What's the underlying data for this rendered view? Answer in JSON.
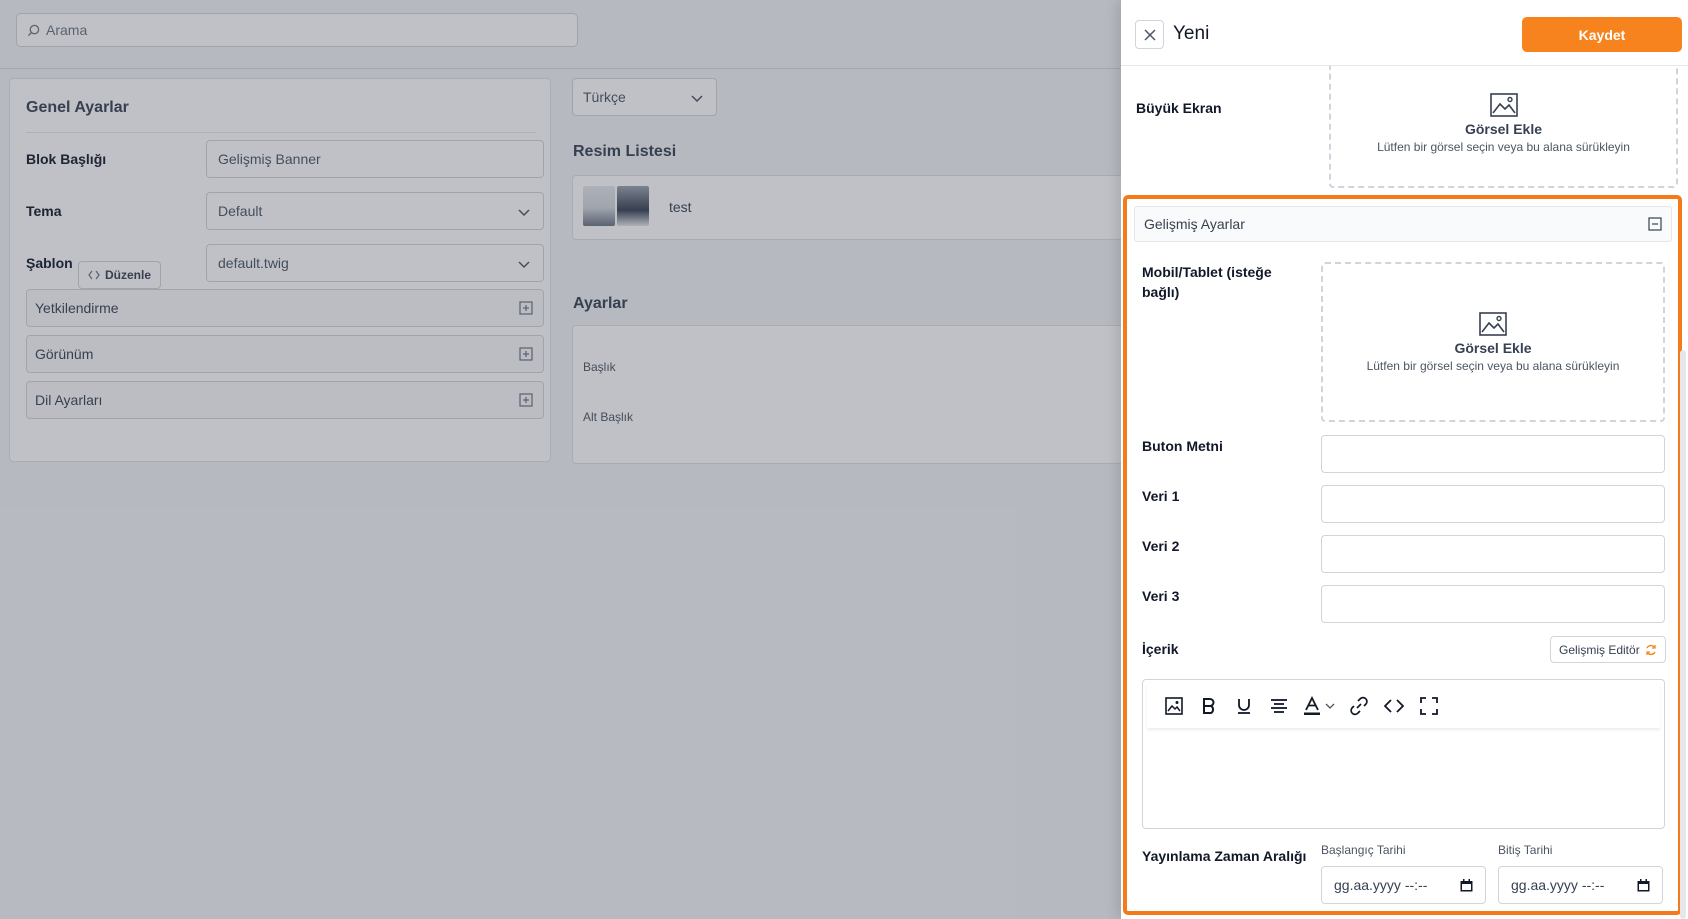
{
  "background": {
    "search_placeholder": "Arama",
    "general_settings": {
      "title": "Genel Ayarlar",
      "block_title_label": "Blok Başlığı",
      "block_title_value": "Gelişmiş Banner",
      "theme_label": "Tema",
      "theme_value": "Default",
      "template_label": "Şablon",
      "edit_button": "Düzenle",
      "template_value": "default.twig",
      "collapsibles": [
        "Yetkilendirme",
        "Görünüm",
        "Dil Ayarları"
      ]
    },
    "language_select": "Türkçe",
    "image_list": {
      "title": "Resim Listesi",
      "item_name": "test"
    },
    "settings": {
      "title": "Ayarlar",
      "fields": [
        "Başlık",
        "Alt Başlık"
      ]
    }
  },
  "drawer": {
    "title": "Yeni",
    "save_button": "Kaydet",
    "large_screen": {
      "label": "Büyük Ekran",
      "dropzone_title": "Görsel Ekle",
      "dropzone_subtitle": "Lütfen bir görsel seçin veya bu alana sürükleyin"
    },
    "advanced": {
      "header": "Gelişmiş Ayarlar",
      "mobile": {
        "label": "Mobil/Tablet (isteğe bağlı)",
        "dropzone_title": "Görsel Ekle",
        "dropzone_subtitle": "Lütfen bir görsel seçin veya bu alana sürükleyin"
      },
      "button_text_label": "Buton Metni",
      "data1_label": "Veri 1",
      "data2_label": "Veri 2",
      "data3_label": "Veri 3",
      "content_label": "İçerik",
      "advanced_editor_button": "Gelişmiş Editör",
      "toolbar": [
        "image-icon",
        "bold-icon",
        "underline-icon",
        "align-center-icon",
        "text-color-icon",
        "link-icon",
        "code-icon",
        "fullscreen-icon"
      ],
      "publish_range_label": "Yayınlama Zaman Aralığı",
      "start_date_label": "Başlangıç Tarihi",
      "start_date_placeholder": "gg.aa.yyyy --:--",
      "end_date_label": "Bitiş Tarihi",
      "end_date_placeholder": "gg.aa.yyyy --:--"
    }
  },
  "colors": {
    "accent": "#f7831f",
    "highlight_frame": "#f47a1a"
  }
}
